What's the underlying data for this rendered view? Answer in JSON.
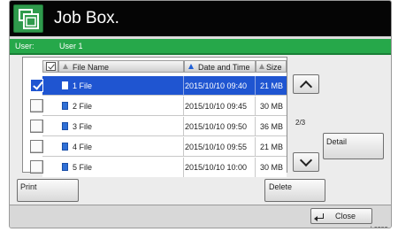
{
  "header": {
    "title": "Job Box."
  },
  "userbar": {
    "label": "User:",
    "name": "User 1"
  },
  "table": {
    "columns": {
      "name": "File Name",
      "date": "Date and Time",
      "size": "Size"
    },
    "rows": [
      {
        "name": "1 File",
        "date": "2015/10/10 09:40",
        "size": "21  MB",
        "selected": true
      },
      {
        "name": "2 File",
        "date": "2015/10/10 09:45",
        "size": "30  MB",
        "selected": false
      },
      {
        "name": "3 File",
        "date": "2015/10/10 09:50",
        "size": "36  MB",
        "selected": false
      },
      {
        "name": "4 File",
        "date": "2015/10/10 09:55",
        "size": "21  MB",
        "selected": false
      },
      {
        "name": "5 File",
        "date": "2015/10/10 10:00",
        "size": "30  MB",
        "selected": false
      }
    ]
  },
  "pagination": {
    "indicator": "2/3"
  },
  "buttons": {
    "detail": "Detail",
    "print": "Print",
    "delete": "Delete",
    "close": "Close"
  },
  "footer": {
    "code": "b0202"
  },
  "colors": {
    "title_bg": "#050505",
    "user_bar": "#26a84a",
    "selection": "#1f55d1"
  },
  "icons": [
    "job-box-icon",
    "checkbox-icon",
    "file-icon",
    "chevron-up-icon",
    "chevron-down-icon",
    "enter-icon"
  ]
}
